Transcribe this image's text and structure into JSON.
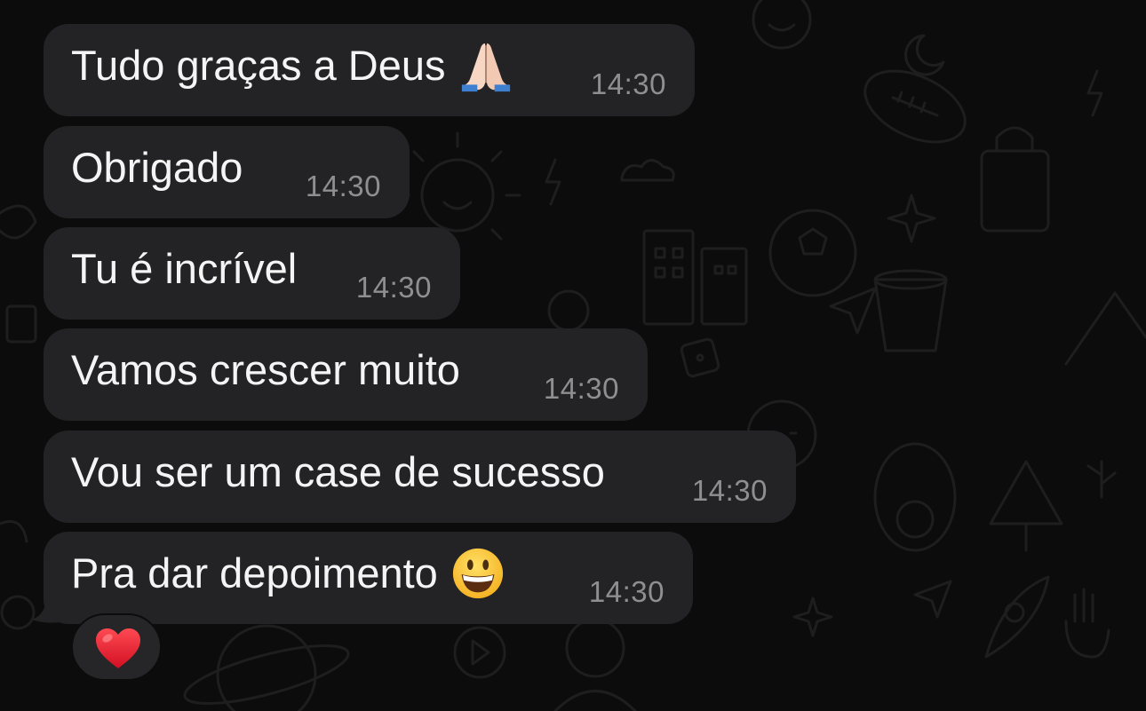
{
  "messages": [
    {
      "text": "Tudo graças a Deus",
      "emoji": "folded-hands-icon",
      "time": "14:30"
    },
    {
      "text": "Obrigado",
      "time": "14:30"
    },
    {
      "text": "Tu é incrível",
      "time": "14:30"
    },
    {
      "text": "Vamos crescer muito",
      "time": "14:30"
    },
    {
      "text": "Vou ser um case de sucesso",
      "time": "14:30"
    },
    {
      "text": "Pra dar depoimento",
      "emoji": "grinning-face-icon",
      "time": "14:30"
    }
  ],
  "reaction": {
    "emoji": "red-heart-icon"
  },
  "colors": {
    "background": "#0c0c0c",
    "bubble": "#232325",
    "message_text": "#f4f4f4",
    "timestamp": "#8e8e93",
    "reaction_heart": "#e8182c"
  }
}
